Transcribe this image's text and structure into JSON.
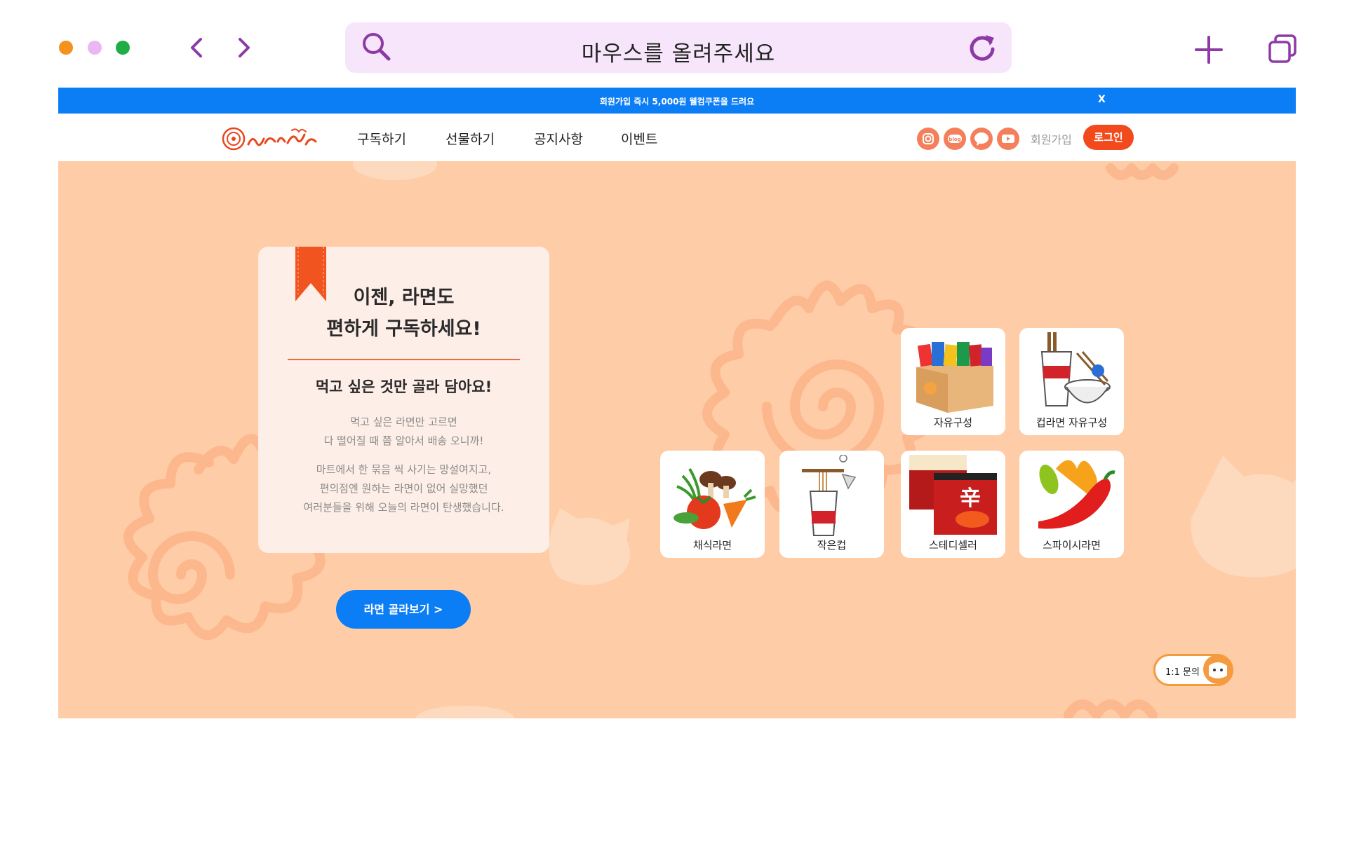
{
  "browser": {
    "address_text": "마우스를 올려주세요"
  },
  "promo": {
    "text": "회원가입 즉시 5,000원 웰컴쿠폰을 드려요",
    "close": "X"
  },
  "nav": {
    "items": [
      "구독하기",
      "선물하기",
      "공지사항",
      "이벤트"
    ],
    "social_icons": [
      "instagram-icon",
      "blog-icon",
      "chat-icon",
      "youtube-icon"
    ],
    "blog_text": "blog",
    "join": "회원가입",
    "login": "로그인"
  },
  "hero": {
    "headline_1": "이젠, 라면도",
    "headline_2": "편하게 구독하세요!",
    "subhead": "먹고 싶은 것만 골라 담아요!",
    "desc1_line1": "먹고 싶은 라면만 고르면",
    "desc1_line2": "다 떨어질 때 쯤 알아서 배송 오니까!",
    "desc2_line1": "마트에서 한 묶음 씩 사기는 망설여지고,",
    "desc2_line2": "편의점엔 원하는 라면이 없어 실망했던",
    "desc2_line3": "여러분들을 위해 오늘의 라면이 탄생했습니다.",
    "cta": "라면 골라보기  >"
  },
  "categories": [
    {
      "label": "자유구성",
      "icon": "ramen-box-icon"
    },
    {
      "label": "컵라면 자유구성",
      "icon": "cup-noodle-icon"
    },
    {
      "label": "채식라면",
      "icon": "vegetables-icon"
    },
    {
      "label": "작은컵",
      "icon": "mini-cup-icon"
    },
    {
      "label": "스테디셀러",
      "icon": "shin-ramyun-icon"
    },
    {
      "label": "스파이시라면",
      "icon": "chili-pepper-icon"
    }
  ],
  "chat_button": "1:1 문의",
  "colors": {
    "accent_blue": "#0b7df5",
    "accent_orange": "#f24a1c",
    "hero_bg": "#fecda7",
    "card_bg": "#fdeee7"
  }
}
